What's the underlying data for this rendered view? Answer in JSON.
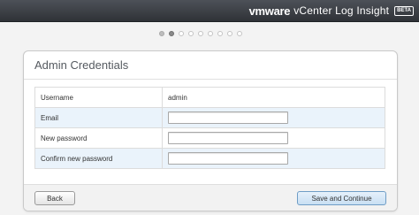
{
  "header": {
    "brand_vm": "vmware",
    "product": "vCenter Log Insight",
    "badge": "BETA"
  },
  "steps": {
    "total": 9,
    "current": 2
  },
  "card": {
    "title": "Admin Credentials",
    "rows": [
      {
        "label": "Username",
        "value": "admin"
      },
      {
        "label": "Email",
        "value": ""
      },
      {
        "label": "New password",
        "value": ""
      },
      {
        "label": "Confirm new password",
        "value": ""
      }
    ]
  },
  "footer": {
    "back_label": "Back",
    "continue_label": "Save and Continue"
  },
  "colors": {
    "header_bg": "#3d4046",
    "row_alt_bg": "#eaf3fb",
    "primary_button_bg": "#d6e8f7"
  }
}
